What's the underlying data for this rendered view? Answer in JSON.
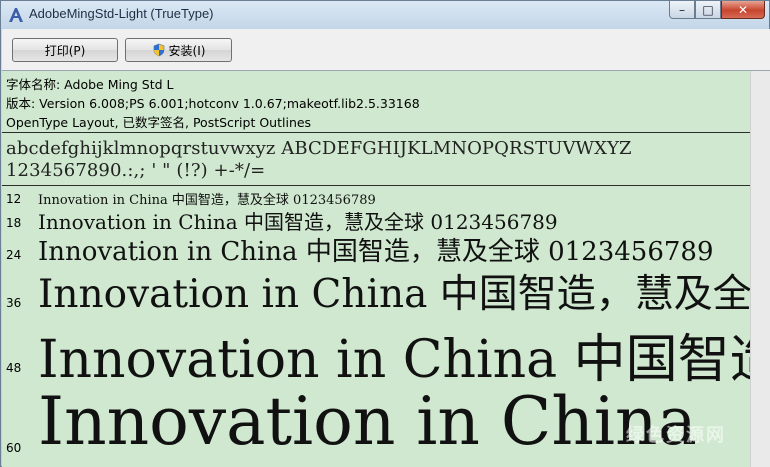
{
  "window": {
    "title": "AdobeMingStd-Light (TrueType)",
    "caption": {
      "minimize": "–",
      "maximize": "□",
      "close": "✕"
    }
  },
  "toolbar": {
    "print_label": "打印(P)",
    "install_label": "安装(I)"
  },
  "info": {
    "font_name": "字体名称: Adobe Ming Std L",
    "version": "版本: Version 6.008;PS 6.001;hotconv 1.0.67;makeotf.lib2.5.33168",
    "features": "OpenType Layout, 已数字签名, PostScript Outlines"
  },
  "charset": {
    "line1": "abcdefghijklmnopqrstuvwxyz ABCDEFGHIJKLMNOPQRSTUVWXYZ",
    "line2": "1234567890.:,; ' \" (!?) +-*/="
  },
  "samples": [
    {
      "size": "12",
      "text": "Innovation in China 中国智造，慧及全球 0123456789"
    },
    {
      "size": "18",
      "text": "Innovation in China 中国智造，慧及全球 0123456789"
    },
    {
      "size": "24",
      "text": "Innovation in China 中国智造，慧及全球 0123456789"
    },
    {
      "size": "36",
      "text": "Innovation in China 中国智造，慧及全球"
    },
    {
      "size": "48",
      "text": "Innovation in China 中国智造"
    },
    {
      "size": "60",
      "text": "Innovation in China"
    }
  ],
  "watermark": "绿色资源网"
}
